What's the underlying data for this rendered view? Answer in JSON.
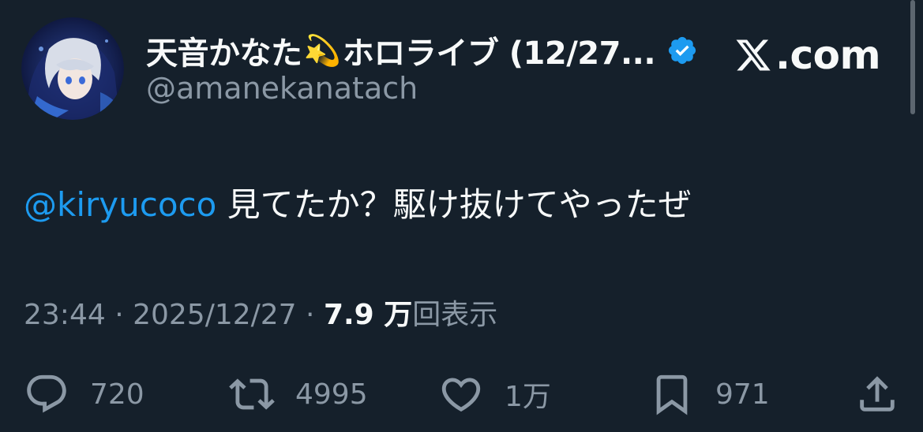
{
  "tweet": {
    "author": {
      "display_name": "天音かなた",
      "emoji": "💫",
      "name_suffix": "ホロライブ (12/27...",
      "handle": "@amanekanatach",
      "verified_icon": "verified-badge-icon",
      "avatar_icon": "avatar"
    },
    "mention": "@kiryucoco",
    "text": " 見てたか？駆け抜けてやったぜ",
    "time": "23:44",
    "separator": " · ",
    "date": "2025/12/27",
    "views_count": "7.9 万",
    "views_label": "回表示",
    "actions": {
      "replies": "720",
      "retweets": "4995",
      "likes": "1万",
      "bookmarks": "971"
    }
  },
  "site": {
    "logo_icon": "x-logo-icon",
    "domain": ".com"
  },
  "colors": {
    "background": "#15202b",
    "text_primary": "#f7f9f9",
    "text_secondary": "#8b98a5",
    "accent": "#1d9bf0"
  }
}
